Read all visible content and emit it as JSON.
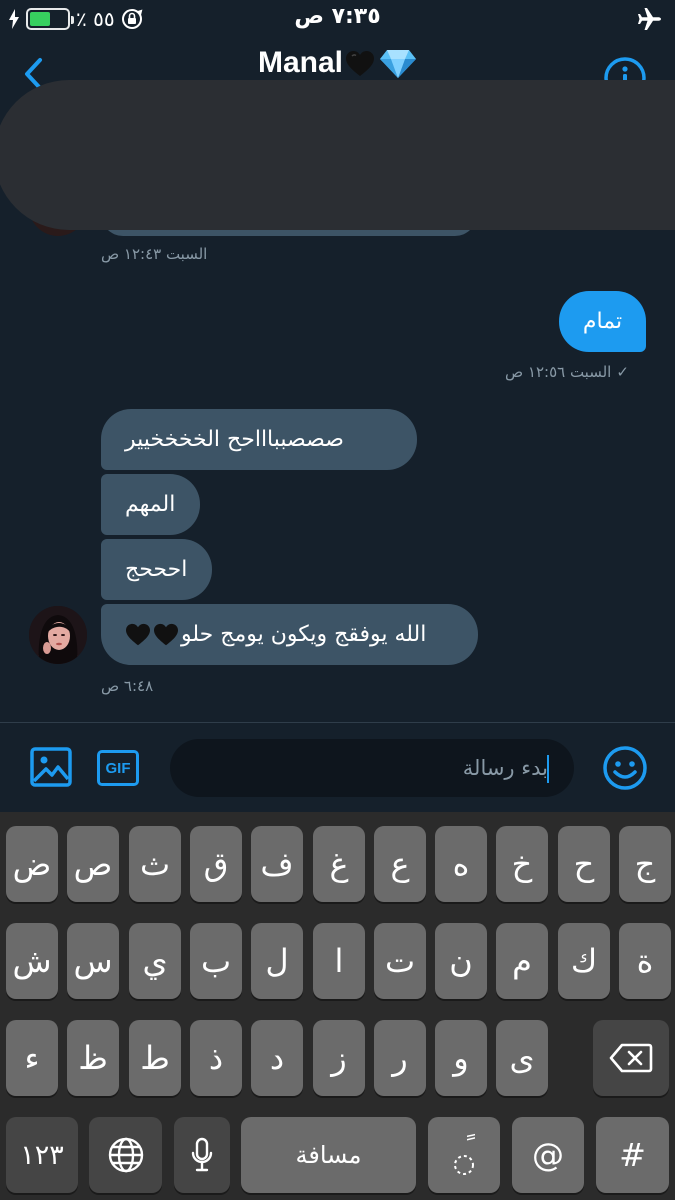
{
  "status_bar": {
    "battery_percent_label": "٪ ٥٥",
    "battery_level": 0.55,
    "time": "٧:٣٥ ص"
  },
  "header": {
    "title": "Manal",
    "title_emojis": [
      "black-heart",
      "gem-stone"
    ]
  },
  "messages": [
    {
      "direction": "incoming",
      "timestamp": "السبت ١٢:٤٣ ص"
    },
    {
      "direction": "outgoing",
      "text": "تمام",
      "timestamp": "السبت ١٢:٥٦ ص",
      "read_mark": "✓"
    },
    {
      "direction": "incoming",
      "text": "صصصبباااحح الخخخخيير"
    },
    {
      "direction": "incoming",
      "text": "المهم"
    },
    {
      "direction": "incoming",
      "text": "احححج"
    },
    {
      "direction": "incoming",
      "text": "الله يوفقج ويكون يومج حلو",
      "emoji_suffix": [
        "black-heart",
        "black-heart"
      ],
      "timestamp": "٦:٤٨ ص"
    }
  ],
  "composer": {
    "placeholder": "بدء رسالة",
    "gif_label": "GIF"
  },
  "keyboard": {
    "row1": [
      "ض",
      "ص",
      "ث",
      "ق",
      "ف",
      "غ",
      "ع",
      "ه",
      "خ",
      "ح",
      "ج"
    ],
    "row2": [
      "ش",
      "س",
      "ي",
      "ب",
      "ل",
      "ا",
      "ت",
      "ن",
      "م",
      "ك",
      "ة"
    ],
    "row3": [
      "ء",
      "ظ",
      "ط",
      "ذ",
      "د",
      "ز",
      "ر",
      "و",
      "ى"
    ],
    "numbers_label": "١٢٣",
    "space_label": "مسافة",
    "tanween_label": "ً",
    "at_label": "@",
    "hash_label": "#"
  },
  "colors": {
    "background": "#15202b",
    "accent": "#1d9bf0",
    "incoming_bubble": "#3d5466",
    "battery_green": "#37d05f"
  }
}
